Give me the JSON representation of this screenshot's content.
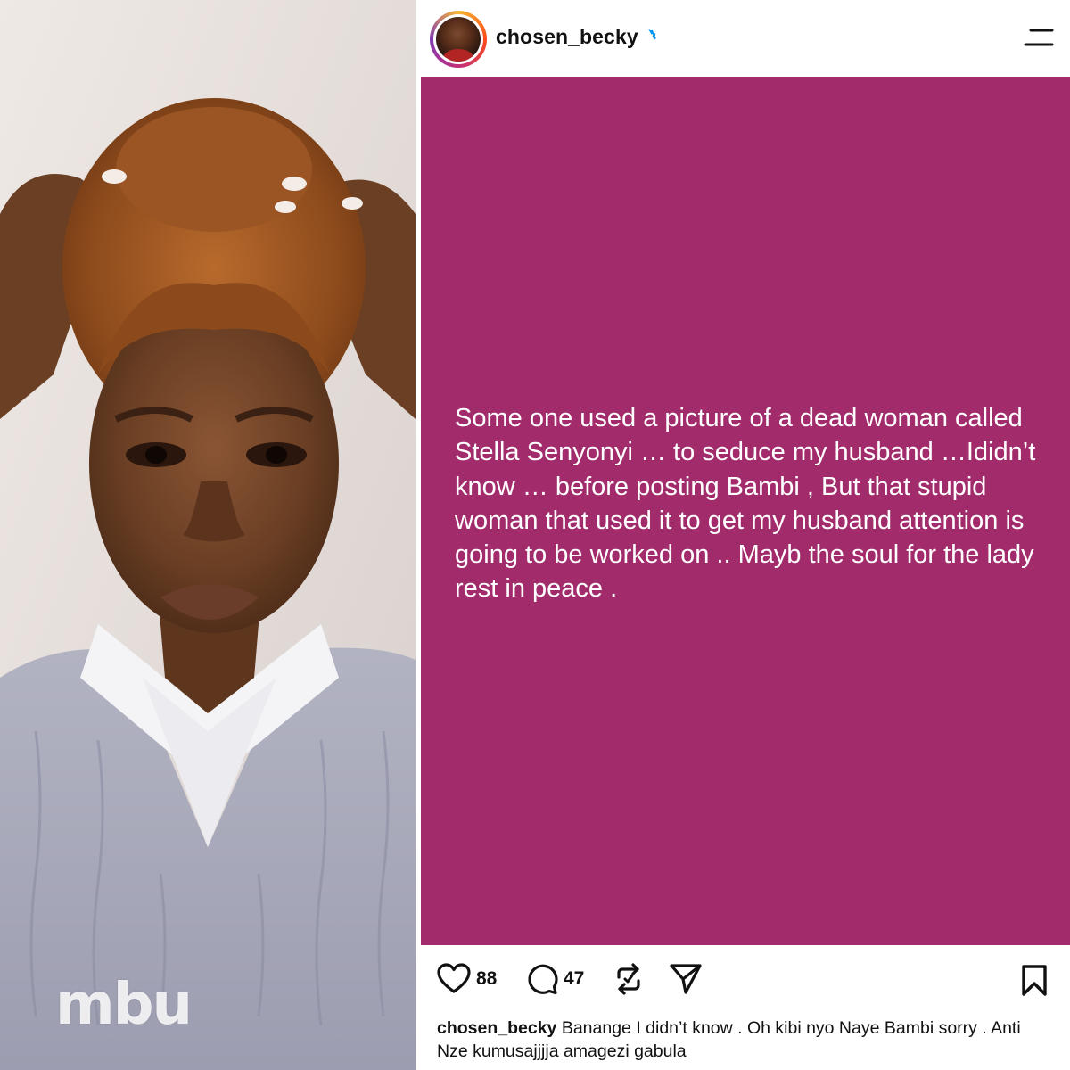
{
  "photo": {
    "watermark": "mbu"
  },
  "post": {
    "username": "chosen_becky",
    "verified": true,
    "background_color": "#a22b6c",
    "text": "Some one used a picture of a dead woman called Stella Senyonyi … to seduce my husband …Ididn’t  know … before posting Bambi , But that stupid woman that used it to get my husband attention is going to be worked on .. Mayb the soul for the lady rest in peace .",
    "likes": "88",
    "comments": "47",
    "caption_user": "chosen_becky",
    "caption_text": "Banange I didn’t know . Oh kibi nyo Naye Bambi sorry . Anti Nze kumusajjjja amagezi gabula"
  },
  "icons": {
    "menu": "hamburger-menu-icon",
    "verified": "verified-badge-icon",
    "like": "heart-icon",
    "comment": "comment-bubble-icon",
    "repost": "repost-icon",
    "share": "send-icon",
    "save": "bookmark-icon"
  },
  "colors": {
    "verified_blue": "#0095f6",
    "post_bg": "#a22b6c"
  }
}
